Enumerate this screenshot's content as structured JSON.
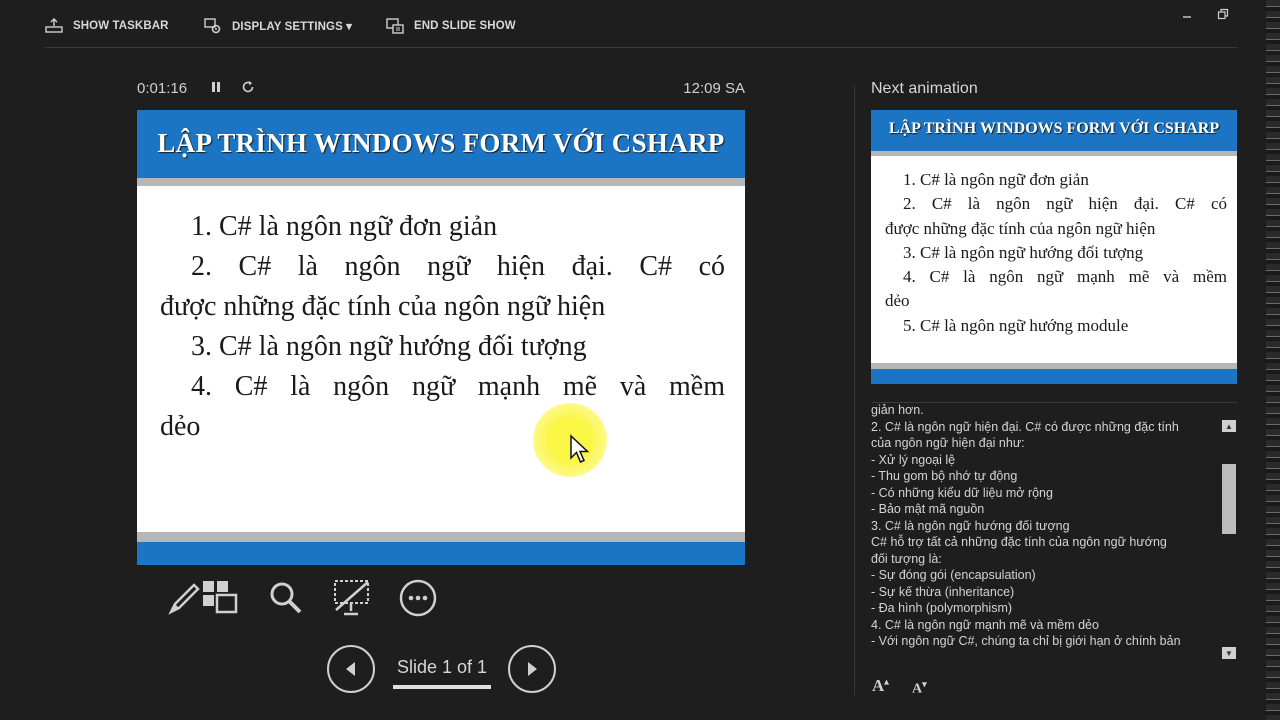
{
  "topbar": {
    "show_taskbar": "SHOW TASKBAR",
    "display_settings": "DISPLAY SETTINGS ▾",
    "end_slide_show": "END SLIDE SHOW"
  },
  "presenter": {
    "elapsed_time": "0:01:16",
    "clock": "12:09 SA"
  },
  "current_slide": {
    "title": "LẬP TRÌNH WINDOWS FORM VỚI CSHARP",
    "lines": [
      "1.  C# là ngôn ngữ đơn giản",
      "2.  C# là ngôn ngữ hiện đại. C# có",
      "được những đặc tính của ngôn ngữ hiện",
      "3.  C# là ngôn ngữ hướng đối tượng",
      "4.  C# là ngôn ngữ mạnh mẽ và mềm",
      "dẻo"
    ]
  },
  "next_animation": {
    "label": "Next animation",
    "title": "LẬP TRÌNH WINDOWS FORM VỚI CSHARP",
    "lines": [
      "1.  C# là ngôn ngữ đơn giản",
      "2.  C# là ngôn ngữ hiện đại. C# có",
      "được những đặc tính của ngôn ngữ hiện",
      "3.  C# là ngôn ngữ hướng đối tượng",
      "4.  C# là ngôn ngữ mạnh mẽ và mềm",
      "dẻo",
      "5.  C# là ngôn ngữ hướng module"
    ]
  },
  "navigation": {
    "slide_counter": "Slide 1 of 1"
  },
  "notes": {
    "lines": [
      "giản hơn.",
      "2.  C# là ngôn ngữ hiện đại. C# có được những đặc tính",
      "của ngôn ngữ hiện đại như:",
      "- Xử lý ngoại lệ",
      "- Thu gom bộ nhớ tự động",
      "- Có những kiểu dữ liệu mở rộng",
      "- Bảo mật mã nguồn",
      "3.  C# là ngôn ngữ hướng đối tượng",
      "C# hỗ trợ tất cả những đặc tính của ngôn ngữ hướng",
      "đối tượng là:",
      "- Sự đóng gói (encapsulation)",
      "- Sự kế thừa (inheritance)",
      "- Đa hình (polymorphism)",
      "4.  C# là ngôn ngữ mạnh mẽ và mềm dẻo",
      "- Với ngôn ngữ C#, chúng ta chỉ bị giới hạn ở chính bản"
    ],
    "font_increase": "A",
    "font_decrease": "A"
  }
}
